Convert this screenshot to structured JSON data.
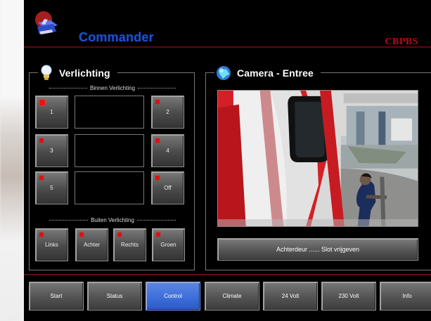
{
  "app": {
    "title": "Commander",
    "brand": "CBPBS"
  },
  "lighting": {
    "title": "Verlichting",
    "icon": "bulb-icon",
    "inside_label": "Binnen Verlichting",
    "inside_buttons": [
      {
        "label": "1",
        "active": true
      },
      {
        "label": "2",
        "active": false
      },
      {
        "label": "3",
        "active": false
      },
      {
        "label": "4",
        "active": false
      },
      {
        "label": "5",
        "active": false
      },
      {
        "label": "Off",
        "active": false
      }
    ],
    "outside_label": "Buiten Verlichting",
    "outside_buttons": [
      {
        "label": "Links"
      },
      {
        "label": "Achter"
      },
      {
        "label": "Rechts"
      },
      {
        "label": "Groen"
      }
    ]
  },
  "camera": {
    "title": "Camera - Entree",
    "icon": "globe-icon",
    "image_name": "camera-feed-image",
    "release_label": "Achterdeur ...... Slot vrijgeven"
  },
  "navigation": {
    "items": [
      {
        "label": "Start",
        "selected": false
      },
      {
        "label": "Status",
        "selected": false
      },
      {
        "label": "Control",
        "selected": true
      },
      {
        "label": "Climate",
        "selected": false
      },
      {
        "label": "24 Volt",
        "selected": false
      },
      {
        "label": "230 Volt",
        "selected": false
      },
      {
        "label": "Info",
        "selected": false
      }
    ]
  },
  "colors": {
    "background": "#000000",
    "title_blue": "#1f4fd1",
    "brand_red": "#b10d18",
    "selected_nav": "#3e6fda",
    "led_red": "#d11111"
  }
}
